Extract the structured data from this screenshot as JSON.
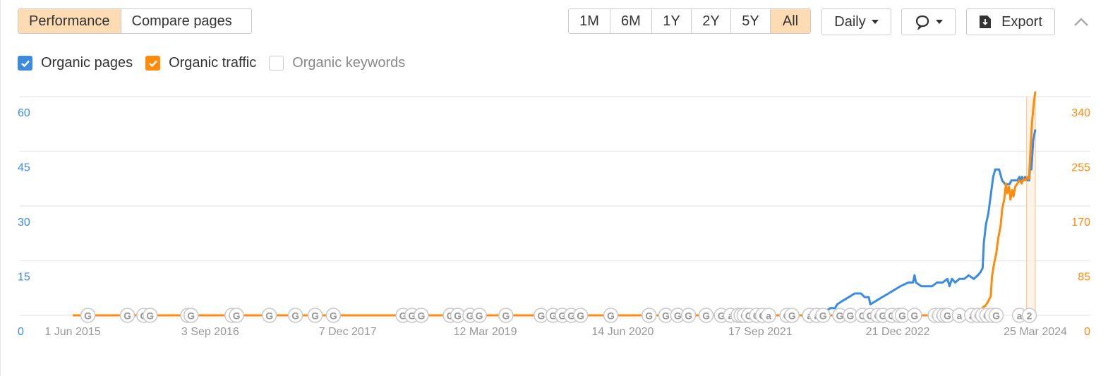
{
  "toolbar": {
    "view_tabs": [
      {
        "label": "Performance",
        "active": true
      },
      {
        "label": "Compare pages",
        "active": false
      }
    ],
    "range_tabs": [
      {
        "label": "1M",
        "active": false
      },
      {
        "label": "6M",
        "active": false
      },
      {
        "label": "1Y",
        "active": false
      },
      {
        "label": "2Y",
        "active": false
      },
      {
        "label": "5Y",
        "active": false
      },
      {
        "label": "All",
        "active": true
      }
    ],
    "interval_dropdown": "Daily",
    "annotations_dropdown_icon": "comment-icon",
    "export_label": "Export",
    "export_icon": "download-file-icon",
    "collapse_icon": "chevron-up-icon"
  },
  "legend": [
    {
      "label": "Organic pages",
      "checked": true,
      "color": "#3d8be0"
    },
    {
      "label": "Organic traffic",
      "checked": true,
      "color": "#ff8a0c"
    },
    {
      "label": "Organic keywords",
      "checked": false,
      "color": "#cccccc"
    }
  ],
  "chart_data": {
    "type": "line",
    "title": "",
    "x_axis": {
      "type": "date",
      "range": [
        "2015-06-01",
        "2024-03-25"
      ],
      "tick_labels": [
        "1 Jun 2015",
        "3 Sep 2016",
        "7 Dec 2017",
        "12 Mar 2019",
        "14 Jun 2020",
        "17 Sep 2021",
        "21 Dec 2022",
        "25 Mar 2024"
      ],
      "tick_dates": [
        "2015-06-01",
        "2016-09-03",
        "2017-12-07",
        "2019-03-12",
        "2020-06-14",
        "2021-09-17",
        "2022-12-21",
        "2024-03-25"
      ]
    },
    "y_left": {
      "label": "Organic pages",
      "range": [
        0,
        60
      ],
      "ticks": [
        0,
        15,
        30,
        45,
        60
      ],
      "color": "#3d8be0"
    },
    "y_right": {
      "label": "Organic traffic",
      "range": [
        0,
        340
      ],
      "ticks": [
        0,
        85,
        170,
        255,
        340
      ],
      "color": "#ff8a0c"
    },
    "grid": true,
    "highlight_range": [
      "2024-02-25",
      "2024-03-25"
    ],
    "series": [
      {
        "name": "Organic pages",
        "axis": "left",
        "color": "#3d8be0",
        "points": [
          [
            "2022-04-01",
            0
          ],
          [
            "2022-04-20",
            1
          ],
          [
            "2022-05-10",
            2
          ],
          [
            "2022-05-25",
            2
          ],
          [
            "2022-06-01",
            3
          ],
          [
            "2022-06-20",
            4
          ],
          [
            "2022-07-10",
            5
          ],
          [
            "2022-07-30",
            6
          ],
          [
            "2022-08-20",
            6
          ],
          [
            "2022-09-01",
            5
          ],
          [
            "2022-09-15",
            5
          ],
          [
            "2022-09-20",
            3
          ],
          [
            "2022-10-10",
            4
          ],
          [
            "2022-10-30",
            5
          ],
          [
            "2022-11-20",
            6
          ],
          [
            "2022-12-10",
            7
          ],
          [
            "2022-12-30",
            8
          ],
          [
            "2023-01-25",
            9
          ],
          [
            "2023-02-10",
            9
          ],
          [
            "2023-02-15",
            11
          ],
          [
            "2023-02-20",
            9
          ],
          [
            "2023-03-10",
            8
          ],
          [
            "2023-03-20",
            8
          ],
          [
            "2023-04-15",
            8
          ],
          [
            "2023-05-01",
            9
          ],
          [
            "2023-05-20",
            9
          ],
          [
            "2023-06-05",
            10
          ],
          [
            "2023-06-12",
            8
          ],
          [
            "2023-06-20",
            10
          ],
          [
            "2023-07-01",
            9
          ],
          [
            "2023-07-15",
            10
          ],
          [
            "2023-08-01",
            10
          ],
          [
            "2023-08-15",
            11
          ],
          [
            "2023-09-01",
            10
          ],
          [
            "2023-09-15",
            11
          ],
          [
            "2023-09-25",
            12
          ],
          [
            "2023-10-01",
            13
          ],
          [
            "2023-10-05",
            20
          ],
          [
            "2023-10-12",
            25
          ],
          [
            "2023-10-20",
            28
          ],
          [
            "2023-10-28",
            33
          ],
          [
            "2023-11-05",
            38
          ],
          [
            "2023-11-12",
            40
          ],
          [
            "2023-11-25",
            40
          ],
          [
            "2023-12-05",
            37
          ],
          [
            "2023-12-15",
            36
          ],
          [
            "2023-12-30",
            36
          ],
          [
            "2024-01-05",
            37
          ],
          [
            "2024-01-15",
            37
          ],
          [
            "2024-01-25",
            37
          ],
          [
            "2024-02-01",
            38
          ],
          [
            "2024-02-05",
            37
          ],
          [
            "2024-02-10",
            38
          ],
          [
            "2024-02-15",
            37
          ],
          [
            "2024-02-20",
            38
          ],
          [
            "2024-02-28",
            37
          ],
          [
            "2024-03-05",
            37
          ],
          [
            "2024-03-08",
            42
          ],
          [
            "2024-03-12",
            40
          ],
          [
            "2024-03-18",
            48
          ],
          [
            "2024-03-25",
            51
          ]
        ]
      },
      {
        "name": "Organic traffic",
        "axis": "right",
        "color": "#ff8a0c",
        "points": [
          [
            "2015-06-01",
            0
          ],
          [
            "2023-08-20",
            0
          ],
          [
            "2023-08-28",
            3
          ],
          [
            "2023-09-10",
            5
          ],
          [
            "2023-09-25",
            7
          ],
          [
            "2023-10-01",
            12
          ],
          [
            "2023-10-10",
            15
          ],
          [
            "2023-10-20",
            22
          ],
          [
            "2023-10-28",
            30
          ],
          [
            "2023-11-01",
            60
          ],
          [
            "2023-11-08",
            80
          ],
          [
            "2023-11-15",
            95
          ],
          [
            "2023-11-22",
            120
          ],
          [
            "2023-11-30",
            140
          ],
          [
            "2023-12-05",
            165
          ],
          [
            "2023-12-12",
            180
          ],
          [
            "2023-12-18",
            205
          ],
          [
            "2023-12-22",
            190
          ],
          [
            "2023-12-28",
            200
          ],
          [
            "2024-01-02",
            180
          ],
          [
            "2024-01-08",
            195
          ],
          [
            "2024-01-12",
            185
          ],
          [
            "2024-01-18",
            200
          ],
          [
            "2024-01-25",
            205
          ],
          [
            "2024-02-01",
            210
          ],
          [
            "2024-02-08",
            205
          ],
          [
            "2024-02-15",
            212
          ],
          [
            "2024-02-22",
            210
          ],
          [
            "2024-02-28",
            215
          ],
          [
            "2024-03-04",
            212
          ],
          [
            "2024-03-08",
            250
          ],
          [
            "2024-03-14",
            300
          ],
          [
            "2024-03-20",
            330
          ],
          [
            "2024-03-25",
            348
          ]
        ]
      }
    ],
    "annotation_markers": [
      {
        "date": "2015-07-22",
        "label": "G"
      },
      {
        "date": "2015-12-01",
        "label": "G"
      },
      {
        "date": "2016-01-25",
        "label": "G"
      },
      {
        "date": "2016-02-15",
        "label": "G"
      },
      {
        "date": "2016-06-20",
        "label": "G"
      },
      {
        "date": "2016-07-01",
        "label": "G"
      },
      {
        "date": "2016-11-15",
        "label": "G"
      },
      {
        "date": "2016-11-30",
        "label": "G"
      },
      {
        "date": "2017-03-20",
        "label": "G"
      },
      {
        "date": "2017-06-15",
        "label": "G"
      },
      {
        "date": "2017-08-20",
        "label": "G"
      },
      {
        "date": "2017-10-20",
        "label": "G"
      },
      {
        "date": "2018-06-10",
        "label": "G"
      },
      {
        "date": "2018-07-10",
        "label": "G"
      },
      {
        "date": "2018-08-10",
        "label": "G"
      },
      {
        "date": "2018-11-15",
        "label": "G"
      },
      {
        "date": "2018-12-10",
        "label": "G"
      },
      {
        "date": "2019-01-20",
        "label": "G"
      },
      {
        "date": "2019-02-20",
        "label": "G"
      },
      {
        "date": "2019-05-20",
        "label": "G"
      },
      {
        "date": "2019-09-15",
        "label": "G"
      },
      {
        "date": "2019-10-25",
        "label": "G"
      },
      {
        "date": "2019-11-25",
        "label": "G"
      },
      {
        "date": "2019-12-25",
        "label": "G"
      },
      {
        "date": "2020-01-25",
        "label": "G"
      },
      {
        "date": "2020-05-05",
        "label": "G"
      },
      {
        "date": "2020-09-10",
        "label": "G"
      },
      {
        "date": "2020-11-05",
        "label": "G"
      },
      {
        "date": "2020-12-15",
        "label": "G"
      },
      {
        "date": "2021-01-20",
        "label": "G"
      },
      {
        "date": "2021-03-20",
        "label": "G"
      },
      {
        "date": "2021-05-10",
        "label": "G"
      },
      {
        "date": "2021-06-10",
        "label": "a"
      },
      {
        "date": "2021-07-05",
        "label": "G"
      },
      {
        "date": "2021-07-15",
        "label": "G"
      },
      {
        "date": "2021-07-25",
        "label": "G"
      },
      {
        "date": "2021-08-10",
        "label": "G"
      },
      {
        "date": "2021-09-05",
        "label": "G"
      },
      {
        "date": "2021-09-25",
        "label": "G"
      },
      {
        "date": "2021-10-15",
        "label": "a"
      },
      {
        "date": "2021-12-15",
        "label": "G"
      },
      {
        "date": "2022-01-01",
        "label": "G"
      },
      {
        "date": "2022-03-01",
        "label": "a"
      },
      {
        "date": "2022-03-25",
        "label": "a"
      },
      {
        "date": "2022-04-15",
        "label": "G"
      },
      {
        "date": "2022-06-10",
        "label": "G"
      },
      {
        "date": "2022-07-15",
        "label": "G"
      },
      {
        "date": "2022-08-25",
        "label": "G"
      },
      {
        "date": "2022-09-20",
        "label": "G"
      },
      {
        "date": "2022-10-15",
        "label": "G"
      },
      {
        "date": "2022-11-01",
        "label": "G"
      },
      {
        "date": "2022-12-01",
        "label": "G"
      },
      {
        "date": "2022-12-25",
        "label": "G"
      },
      {
        "date": "2023-01-05",
        "label": "G"
      },
      {
        "date": "2023-02-15",
        "label": "G"
      },
      {
        "date": "2023-04-25",
        "label": "G"
      },
      {
        "date": "2023-05-10",
        "label": "G"
      },
      {
        "date": "2023-05-25",
        "label": "G"
      },
      {
        "date": "2023-06-05",
        "label": "G"
      },
      {
        "date": "2023-07-15",
        "label": "a"
      },
      {
        "date": "2023-08-25",
        "label": "a"
      },
      {
        "date": "2023-09-15",
        "label": "G"
      },
      {
        "date": "2023-10-01",
        "label": "G"
      },
      {
        "date": "2023-10-15",
        "label": "G"
      },
      {
        "date": "2023-11-01",
        "label": "G"
      },
      {
        "date": "2023-11-15",
        "label": "G"
      },
      {
        "date": "2024-02-01",
        "label": "a"
      },
      {
        "date": "2024-03-05",
        "label": "2"
      }
    ]
  }
}
